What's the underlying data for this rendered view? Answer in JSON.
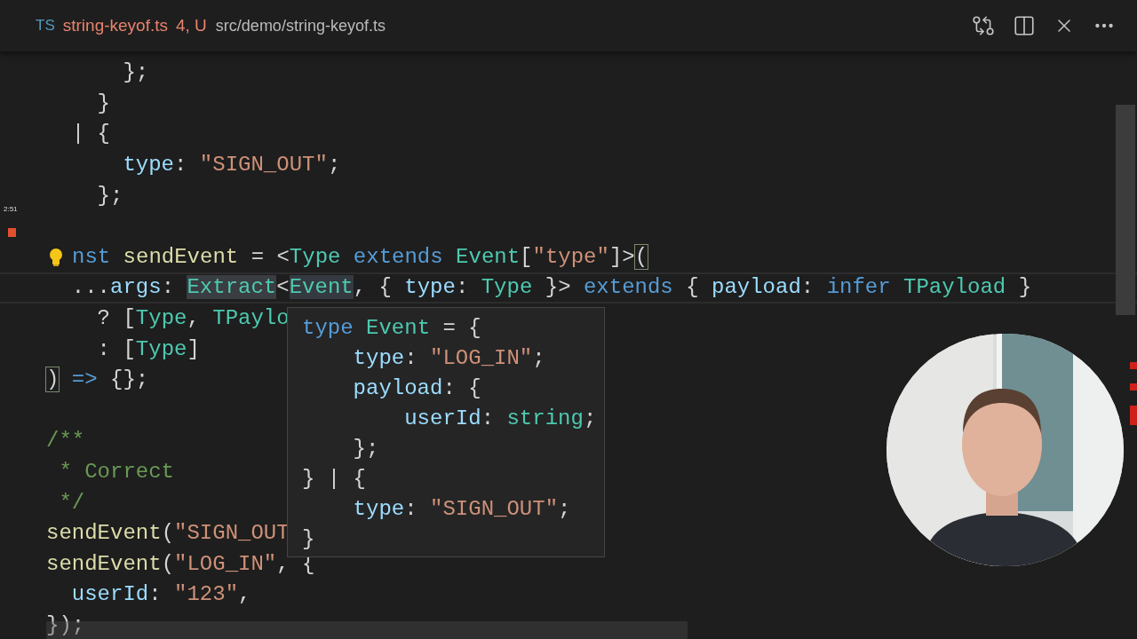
{
  "tab": {
    "language": "TS",
    "filename": "string-keyof.ts",
    "status": "4, U",
    "path": "src/demo/string-keyof.ts"
  },
  "gutter": {
    "time": "2:51"
  },
  "lines": [
    {
      "kind": "code",
      "tokens": [
        {
          "text": "      };",
          "kind": "punct"
        }
      ]
    },
    {
      "kind": "code",
      "tokens": [
        {
          "text": "    }",
          "kind": "punct"
        }
      ]
    },
    {
      "kind": "code",
      "tokens": [
        {
          "text": "  | {",
          "kind": "punct"
        }
      ]
    },
    {
      "kind": "code",
      "tokens": [
        {
          "text": "      type",
          "kind": "property"
        },
        {
          "text": ": ",
          "kind": "punct"
        },
        {
          "text": "\"SIGN_OUT\"",
          "kind": "string"
        },
        {
          "text": ";",
          "kind": "punct"
        }
      ]
    },
    {
      "kind": "code",
      "tokens": [
        {
          "text": "    };",
          "kind": "punct"
        }
      ]
    },
    {
      "kind": "blank"
    },
    {
      "kind": "code",
      "hint": true,
      "tokens": [
        {
          "text": "nst ",
          "kind": "keyword"
        },
        {
          "text": "sendEvent",
          "kind": "function"
        },
        {
          "text": " = <",
          "kind": "punct"
        },
        {
          "text": "Type ",
          "kind": "type"
        },
        {
          "text": "extends ",
          "kind": "keyword"
        },
        {
          "text": "Event",
          "kind": "type"
        },
        {
          "text": "[",
          "kind": "punct"
        },
        {
          "text": "\"type\"",
          "kind": "string"
        },
        {
          "text": "]>",
          "kind": "punct"
        },
        {
          "text": "(",
          "kind": "punct",
          "bracket_match": true
        }
      ]
    },
    {
      "kind": "code",
      "current": true,
      "tokens": [
        {
          "text": "  ...",
          "kind": "punct"
        },
        {
          "text": "args",
          "kind": "property"
        },
        {
          "text": ": ",
          "kind": "punct"
        },
        {
          "text": "Extract",
          "kind": "type",
          "selected": true
        },
        {
          "text": "<",
          "kind": "punct"
        },
        {
          "text": "Event",
          "kind": "type",
          "word_highlight": true
        },
        {
          "text": ", { ",
          "kind": "punct"
        },
        {
          "text": "type",
          "kind": "property"
        },
        {
          "text": ": ",
          "kind": "punct"
        },
        {
          "text": "Type",
          "kind": "type"
        },
        {
          "text": " }> ",
          "kind": "punct"
        },
        {
          "text": "extends",
          "kind": "keyword"
        },
        {
          "text": " { ",
          "kind": "punct"
        },
        {
          "text": "payload",
          "kind": "property"
        },
        {
          "text": ": ",
          "kind": "punct"
        },
        {
          "text": "infer ",
          "kind": "keyword"
        },
        {
          "text": "TPayload",
          "kind": "type"
        },
        {
          "text": " }",
          "kind": "punct"
        }
      ]
    },
    {
      "kind": "code",
      "tokens": [
        {
          "text": "    ? [",
          "kind": "punct"
        },
        {
          "text": "Type",
          "kind": "type"
        },
        {
          "text": ", ",
          "kind": "punct"
        },
        {
          "text": "TPaylo",
          "kind": "type"
        }
      ]
    },
    {
      "kind": "code",
      "tokens": [
        {
          "text": "    : [",
          "kind": "punct"
        },
        {
          "text": "Type",
          "kind": "type"
        },
        {
          "text": "]",
          "kind": "punct"
        }
      ]
    },
    {
      "kind": "code",
      "tokens": [
        {
          "text": ")",
          "kind": "punct",
          "bracket_match": true
        },
        {
          "text": " =>",
          "kind": "keyword"
        },
        {
          "text": " {};",
          "kind": "punct"
        }
      ]
    },
    {
      "kind": "blank"
    },
    {
      "kind": "code",
      "tokens": [
        {
          "text": "/**",
          "kind": "comment"
        }
      ]
    },
    {
      "kind": "code",
      "tokens": [
        {
          "text": " * Correct",
          "kind": "comment"
        }
      ]
    },
    {
      "kind": "code",
      "tokens": [
        {
          "text": " */",
          "kind": "comment"
        }
      ]
    },
    {
      "kind": "code",
      "tokens": [
        {
          "text": "sendEvent",
          "kind": "function"
        },
        {
          "text": "(",
          "kind": "punct"
        },
        {
          "text": "\"SIGN_OUT",
          "kind": "string"
        }
      ]
    },
    {
      "kind": "code",
      "tokens": [
        {
          "text": "sendEvent",
          "kind": "function"
        },
        {
          "text": "(",
          "kind": "punct"
        },
        {
          "text": "\"LOG_IN\"",
          "kind": "string"
        },
        {
          "text": ", {",
          "kind": "punct"
        }
      ]
    },
    {
      "kind": "code",
      "tokens": [
        {
          "text": "  userId",
          "kind": "property"
        },
        {
          "text": ": ",
          "kind": "punct"
        },
        {
          "text": "\"123\"",
          "kind": "string"
        },
        {
          "text": ",",
          "kind": "punct"
        }
      ]
    },
    {
      "kind": "code",
      "tokens": [
        {
          "text": "});",
          "kind": "punct"
        }
      ]
    }
  ],
  "hover": {
    "lines": [
      {
        "tokens": [
          {
            "text": "type ",
            "kind": "keyword"
          },
          {
            "text": "Event",
            "kind": "type"
          },
          {
            "text": " = {",
            "kind": "punct"
          }
        ]
      },
      {
        "tokens": [
          {
            "text": "    type",
            "kind": "property"
          },
          {
            "text": ": ",
            "kind": "punct"
          },
          {
            "text": "\"LOG_IN\"",
            "kind": "string"
          },
          {
            "text": ";",
            "kind": "punct"
          }
        ]
      },
      {
        "tokens": [
          {
            "text": "    payload",
            "kind": "property"
          },
          {
            "text": ": {",
            "kind": "punct"
          }
        ]
      },
      {
        "tokens": [
          {
            "text": "        userId",
            "kind": "property"
          },
          {
            "text": ": ",
            "kind": "punct"
          },
          {
            "text": "string",
            "kind": "type"
          },
          {
            "text": ";",
            "kind": "punct"
          }
        ]
      },
      {
        "tokens": [
          {
            "text": "    };",
            "kind": "punct"
          }
        ]
      },
      {
        "tokens": [
          {
            "text": "} | {",
            "kind": "punct"
          }
        ]
      },
      {
        "tokens": [
          {
            "text": "    type",
            "kind": "property"
          },
          {
            "text": ": ",
            "kind": "punct"
          },
          {
            "text": "\"SIGN_OUT\"",
            "kind": "string"
          },
          {
            "text": ";",
            "kind": "punct"
          }
        ]
      },
      {
        "tokens": [
          {
            "text": "}",
            "kind": "punct"
          }
        ]
      }
    ]
  }
}
